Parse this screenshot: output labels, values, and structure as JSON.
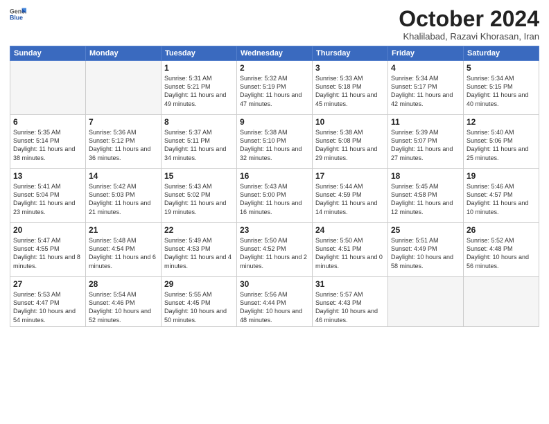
{
  "header": {
    "logo_general": "General",
    "logo_blue": "Blue",
    "month_title": "October 2024",
    "subtitle": "Khalilabad, Razavi Khorasan, Iran"
  },
  "days_of_week": [
    "Sunday",
    "Monday",
    "Tuesday",
    "Wednesday",
    "Thursday",
    "Friday",
    "Saturday"
  ],
  "weeks": [
    [
      {
        "day": "",
        "sunrise": "",
        "sunset": "",
        "daylight": ""
      },
      {
        "day": "",
        "sunrise": "",
        "sunset": "",
        "daylight": ""
      },
      {
        "day": "1",
        "sunrise": "Sunrise: 5:31 AM",
        "sunset": "Sunset: 5:21 PM",
        "daylight": "Daylight: 11 hours and 49 minutes."
      },
      {
        "day": "2",
        "sunrise": "Sunrise: 5:32 AM",
        "sunset": "Sunset: 5:19 PM",
        "daylight": "Daylight: 11 hours and 47 minutes."
      },
      {
        "day": "3",
        "sunrise": "Sunrise: 5:33 AM",
        "sunset": "Sunset: 5:18 PM",
        "daylight": "Daylight: 11 hours and 45 minutes."
      },
      {
        "day": "4",
        "sunrise": "Sunrise: 5:34 AM",
        "sunset": "Sunset: 5:17 PM",
        "daylight": "Daylight: 11 hours and 42 minutes."
      },
      {
        "day": "5",
        "sunrise": "Sunrise: 5:34 AM",
        "sunset": "Sunset: 5:15 PM",
        "daylight": "Daylight: 11 hours and 40 minutes."
      }
    ],
    [
      {
        "day": "6",
        "sunrise": "Sunrise: 5:35 AM",
        "sunset": "Sunset: 5:14 PM",
        "daylight": "Daylight: 11 hours and 38 minutes."
      },
      {
        "day": "7",
        "sunrise": "Sunrise: 5:36 AM",
        "sunset": "Sunset: 5:12 PM",
        "daylight": "Daylight: 11 hours and 36 minutes."
      },
      {
        "day": "8",
        "sunrise": "Sunrise: 5:37 AM",
        "sunset": "Sunset: 5:11 PM",
        "daylight": "Daylight: 11 hours and 34 minutes."
      },
      {
        "day": "9",
        "sunrise": "Sunrise: 5:38 AM",
        "sunset": "Sunset: 5:10 PM",
        "daylight": "Daylight: 11 hours and 32 minutes."
      },
      {
        "day": "10",
        "sunrise": "Sunrise: 5:38 AM",
        "sunset": "Sunset: 5:08 PM",
        "daylight": "Daylight: 11 hours and 29 minutes."
      },
      {
        "day": "11",
        "sunrise": "Sunrise: 5:39 AM",
        "sunset": "Sunset: 5:07 PM",
        "daylight": "Daylight: 11 hours and 27 minutes."
      },
      {
        "day": "12",
        "sunrise": "Sunrise: 5:40 AM",
        "sunset": "Sunset: 5:06 PM",
        "daylight": "Daylight: 11 hours and 25 minutes."
      }
    ],
    [
      {
        "day": "13",
        "sunrise": "Sunrise: 5:41 AM",
        "sunset": "Sunset: 5:04 PM",
        "daylight": "Daylight: 11 hours and 23 minutes."
      },
      {
        "day": "14",
        "sunrise": "Sunrise: 5:42 AM",
        "sunset": "Sunset: 5:03 PM",
        "daylight": "Daylight: 11 hours and 21 minutes."
      },
      {
        "day": "15",
        "sunrise": "Sunrise: 5:43 AM",
        "sunset": "Sunset: 5:02 PM",
        "daylight": "Daylight: 11 hours and 19 minutes."
      },
      {
        "day": "16",
        "sunrise": "Sunrise: 5:43 AM",
        "sunset": "Sunset: 5:00 PM",
        "daylight": "Daylight: 11 hours and 16 minutes."
      },
      {
        "day": "17",
        "sunrise": "Sunrise: 5:44 AM",
        "sunset": "Sunset: 4:59 PM",
        "daylight": "Daylight: 11 hours and 14 minutes."
      },
      {
        "day": "18",
        "sunrise": "Sunrise: 5:45 AM",
        "sunset": "Sunset: 4:58 PM",
        "daylight": "Daylight: 11 hours and 12 minutes."
      },
      {
        "day": "19",
        "sunrise": "Sunrise: 5:46 AM",
        "sunset": "Sunset: 4:57 PM",
        "daylight": "Daylight: 11 hours and 10 minutes."
      }
    ],
    [
      {
        "day": "20",
        "sunrise": "Sunrise: 5:47 AM",
        "sunset": "Sunset: 4:55 PM",
        "daylight": "Daylight: 11 hours and 8 minutes."
      },
      {
        "day": "21",
        "sunrise": "Sunrise: 5:48 AM",
        "sunset": "Sunset: 4:54 PM",
        "daylight": "Daylight: 11 hours and 6 minutes."
      },
      {
        "day": "22",
        "sunrise": "Sunrise: 5:49 AM",
        "sunset": "Sunset: 4:53 PM",
        "daylight": "Daylight: 11 hours and 4 minutes."
      },
      {
        "day": "23",
        "sunrise": "Sunrise: 5:50 AM",
        "sunset": "Sunset: 4:52 PM",
        "daylight": "Daylight: 11 hours and 2 minutes."
      },
      {
        "day": "24",
        "sunrise": "Sunrise: 5:50 AM",
        "sunset": "Sunset: 4:51 PM",
        "daylight": "Daylight: 11 hours and 0 minutes."
      },
      {
        "day": "25",
        "sunrise": "Sunrise: 5:51 AM",
        "sunset": "Sunset: 4:49 PM",
        "daylight": "Daylight: 10 hours and 58 minutes."
      },
      {
        "day": "26",
        "sunrise": "Sunrise: 5:52 AM",
        "sunset": "Sunset: 4:48 PM",
        "daylight": "Daylight: 10 hours and 56 minutes."
      }
    ],
    [
      {
        "day": "27",
        "sunrise": "Sunrise: 5:53 AM",
        "sunset": "Sunset: 4:47 PM",
        "daylight": "Daylight: 10 hours and 54 minutes."
      },
      {
        "day": "28",
        "sunrise": "Sunrise: 5:54 AM",
        "sunset": "Sunset: 4:46 PM",
        "daylight": "Daylight: 10 hours and 52 minutes."
      },
      {
        "day": "29",
        "sunrise": "Sunrise: 5:55 AM",
        "sunset": "Sunset: 4:45 PM",
        "daylight": "Daylight: 10 hours and 50 minutes."
      },
      {
        "day": "30",
        "sunrise": "Sunrise: 5:56 AM",
        "sunset": "Sunset: 4:44 PM",
        "daylight": "Daylight: 10 hours and 48 minutes."
      },
      {
        "day": "31",
        "sunrise": "Sunrise: 5:57 AM",
        "sunset": "Sunset: 4:43 PM",
        "daylight": "Daylight: 10 hours and 46 minutes."
      },
      {
        "day": "",
        "sunrise": "",
        "sunset": "",
        "daylight": ""
      },
      {
        "day": "",
        "sunrise": "",
        "sunset": "",
        "daylight": ""
      }
    ]
  ]
}
